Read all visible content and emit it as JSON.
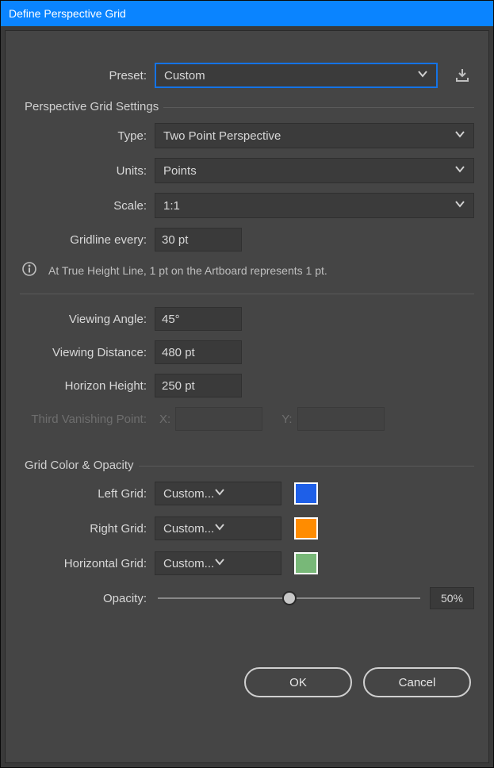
{
  "window_title": "Define Perspective Grid",
  "preset": {
    "label": "Preset:",
    "value": "Custom"
  },
  "sections": {
    "grid": {
      "legend": "Perspective Grid Settings",
      "type": {
        "label": "Type:",
        "value": "Two Point Perspective"
      },
      "units": {
        "label": "Units:",
        "value": "Points"
      },
      "scale": {
        "label": "Scale:",
        "value": "1:1"
      },
      "gridline": {
        "label": "Gridline every:",
        "value": "30 pt"
      },
      "info": "At True Height Line, 1 pt on the Artboard represents 1 pt.",
      "viewing_angle": {
        "label": "Viewing Angle:",
        "value": "45°"
      },
      "viewing_distance": {
        "label": "Viewing Distance:",
        "value": "480 pt"
      },
      "horizon_height": {
        "label": "Horizon Height:",
        "value": "250 pt"
      },
      "third_vp": {
        "label": "Third Vanishing Point:",
        "x_label": "X:",
        "x_value": "",
        "y_label": "Y:",
        "y_value": ""
      }
    },
    "color": {
      "legend": "Grid Color & Opacity",
      "left": {
        "label": "Left Grid:",
        "value": "Custom...",
        "swatch": "#1e5fe8"
      },
      "right": {
        "label": "Right Grid:",
        "value": "Custom...",
        "swatch": "#ff8c00"
      },
      "horiz": {
        "label": "Horizontal Grid:",
        "value": "Custom...",
        "swatch": "#78b878"
      },
      "opacity": {
        "label": "Opacity:",
        "value_pct": 50,
        "display": "50%"
      }
    }
  },
  "buttons": {
    "ok": "OK",
    "cancel": "Cancel"
  }
}
